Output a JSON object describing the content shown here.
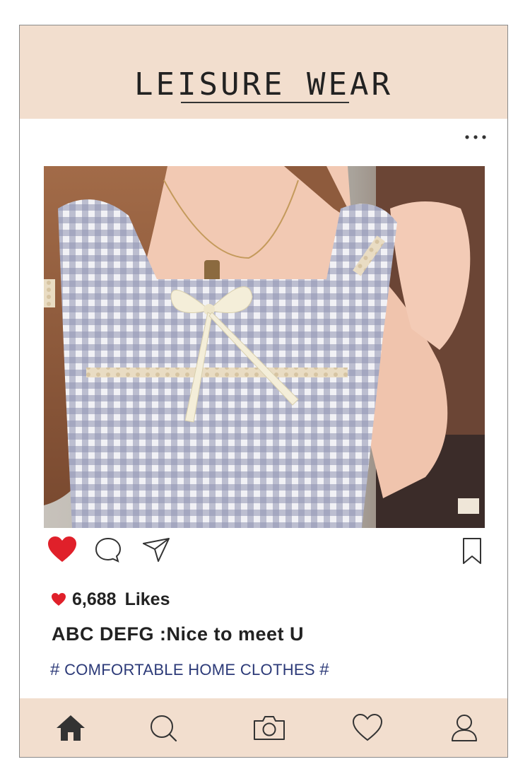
{
  "header": {
    "title": "LEISURE WEAR"
  },
  "post": {
    "image_alt": "Woman wearing blue gingham pajama top with lace trim and cream bow",
    "liked": true,
    "likes_count": "6,688",
    "likes_word": "Likes",
    "caption": "ABC DEFG :Nice to meet U",
    "hashtag_prefix": "#",
    "hashtag_text": " COMFORTABLE HOME CLOTHES ",
    "hashtag_suffix": "#"
  },
  "actions": [
    "heart-icon",
    "comment-icon",
    "share-icon",
    "bookmark-icon"
  ],
  "bottom_nav": [
    "home-icon",
    "search-icon",
    "camera-icon",
    "heart-icon",
    "profile-icon"
  ],
  "colors": {
    "band": "#f2dece",
    "heart": "#e0202a",
    "hashtag": "#2c3a78",
    "text": "#222222"
  }
}
